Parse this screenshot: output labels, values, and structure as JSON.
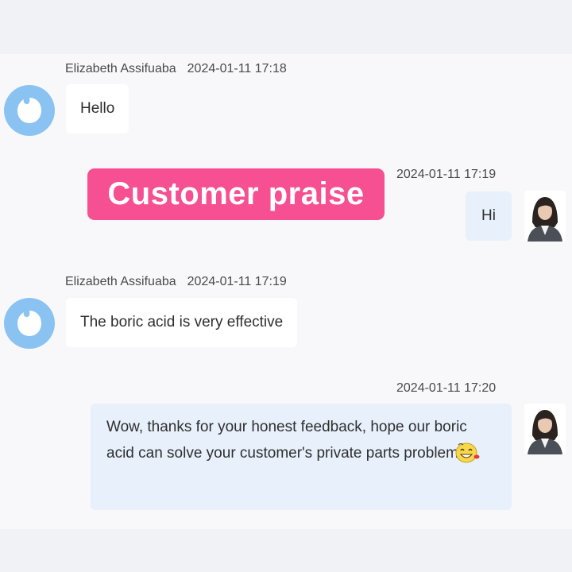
{
  "conversation": {
    "messages": [
      {
        "sender": "Elizabeth Assifuaba",
        "time": "2024-01-11 17:18",
        "text": "Hello",
        "direction": "incoming"
      },
      {
        "sender": "",
        "time": "2024-01-11 17:19",
        "text": "Hi",
        "direction": "outgoing"
      },
      {
        "sender": "Elizabeth Assifuaba",
        "time": "2024-01-11 17:19",
        "text": "The boric acid is very effective",
        "direction": "incoming"
      },
      {
        "sender": "",
        "time": "2024-01-11 17:20",
        "text": "Wow, thanks for your honest feedback, hope our boric acid can solve your customer's private parts problem",
        "direction": "outgoing",
        "emoji": "laughing-face-icon"
      }
    ]
  },
  "overlay": {
    "banner_text": "Customer praise",
    "banner_color": "#f64f92"
  },
  "colors": {
    "incoming_bubble": "#ffffff",
    "outgoing_bubble": "#e7f0fb",
    "bot_avatar": "#8ac3f2"
  }
}
